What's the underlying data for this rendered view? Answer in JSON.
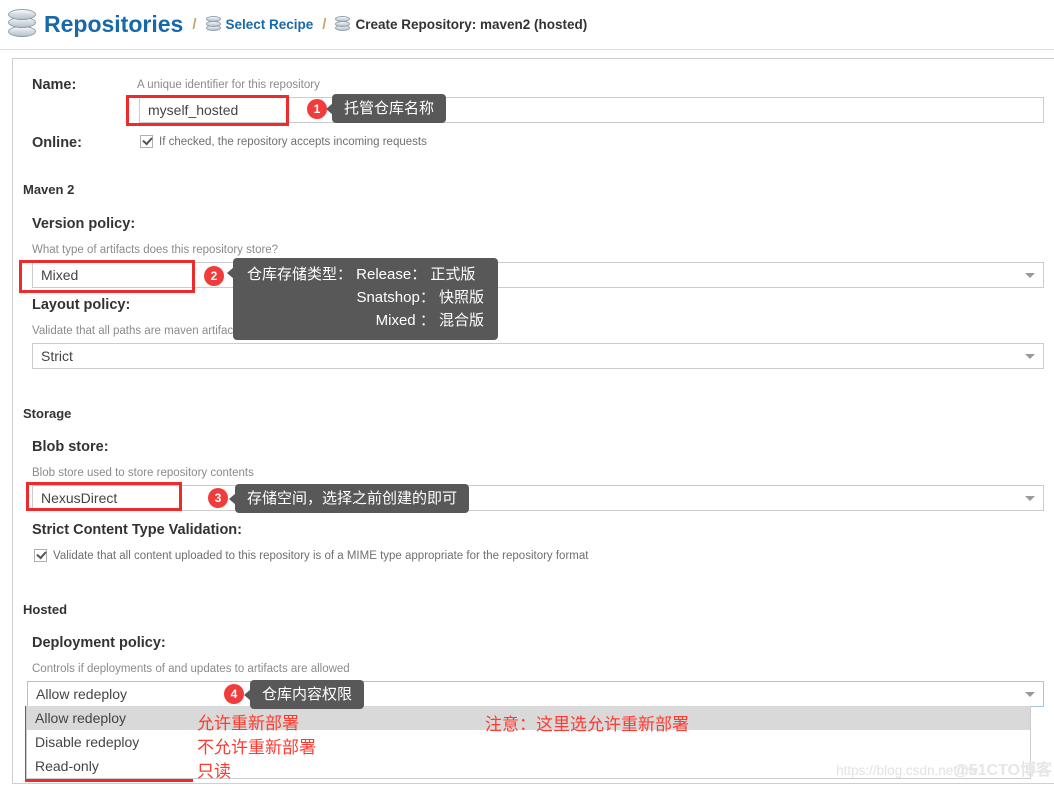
{
  "header": {
    "title": "Repositories",
    "separator": "/",
    "icon_main": "database-icon",
    "crumb2": "Select Recipe",
    "crumb3": "Create Repository: maven2 (hosted)"
  },
  "form": {
    "name_label": "Name:",
    "name_helper": "A unique identifier for this repository",
    "name_value": "myself_hosted",
    "online_label": "Online:",
    "online_check_label": "If checked, the repository accepts incoming requests",
    "maven_section": "Maven 2",
    "version_policy_label": "Version policy:",
    "version_policy_helper": "What type of artifacts does this repository store?",
    "version_policy_value": "Mixed",
    "layout_policy_label": "Layout policy:",
    "layout_policy_helper": "Validate that all paths are maven artifact or metadata paths",
    "layout_policy_value": "Strict",
    "storage_section": "Storage",
    "blob_store_label": "Blob store:",
    "blob_store_helper": "Blob store used to store repository contents",
    "blob_store_value": "NexusDirect",
    "strict_content_label": "Strict Content Type Validation:",
    "strict_content_check_label": "Validate that all content uploaded to this repository is of a MIME type appropriate for the repository format",
    "hosted_section": "Hosted",
    "deployment_policy_label": "Deployment policy:",
    "deployment_policy_helper": "Controls if deployments of and updates to artifacts are allowed",
    "deployment_policy_value": "Allow redeploy",
    "deployment_policy_options": [
      "Allow redeploy",
      "Disable redeploy",
      "Read-only"
    ]
  },
  "annotations": {
    "badge1": "1",
    "badge2": "2",
    "badge3": "3",
    "badge4": "4",
    "tip1": "托管仓库名称",
    "tip2_line1": "仓库存储类型： Release： 正式版",
    "tip2_line2": "Snatshop： 快照版",
    "tip2_line3": "Mixed ： 混合版",
    "tip3": "存储空间，选择之前创建的即可",
    "tip4": "仓库内容权限",
    "note_allow": "允许重新部署",
    "note_disable": "不允许重新部署",
    "note_readonly": "只读",
    "note_attention": "注意：这里选允许重新部署"
  },
  "watermark": {
    "url": "https://blog.csdn.net/hw",
    "brand": "@51CTO博客"
  },
  "colors": {
    "accent_blue": "#1769aa",
    "annotation_red": "#ee2b2b",
    "badge_red": "#f23b3b",
    "tooltip_gray": "#585858",
    "note_red": "#ff3b30"
  }
}
